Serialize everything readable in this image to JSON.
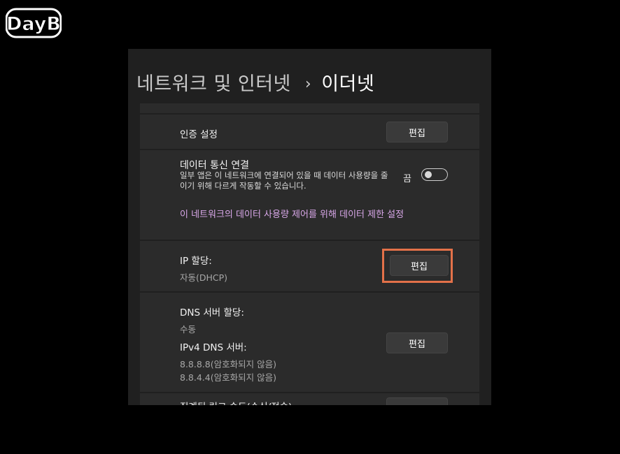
{
  "logo": {
    "text": "DayB"
  },
  "breadcrumb": {
    "parent": "네트워크 및 인터넷",
    "separator": "›",
    "current": "이더넷"
  },
  "auth": {
    "label": "인증 설정",
    "button": "편집"
  },
  "metered": {
    "title": "데이터 통신 연결",
    "description": "일부 앱은 이 네트워크에 연결되어 있을 때 데이터 사용량을 줄이기 위해 다르게 작동할 수 있습니다.",
    "toggle_label": "끔",
    "toggle_state": "off",
    "link": "이 네트워크의 데이터 사용량 제어를 위해 데이터 제한 설정"
  },
  "ip": {
    "label": "IP 할당:",
    "value": "자동(DHCP)",
    "button": "편집"
  },
  "dns": {
    "label": "DNS 서버 할당:",
    "value": "수동",
    "ipv4_label": "IPv4 DNS 서버:",
    "servers": [
      "8.8.8.8(암호화되지 않음)",
      "8.8.4.4(암호화되지 않음)"
    ],
    "button": "편집"
  },
  "link_speed": {
    "label": "집계된 링크 속도(수신/전송):"
  },
  "colors": {
    "highlight": "#e37149",
    "link": "#d8a7e8"
  }
}
